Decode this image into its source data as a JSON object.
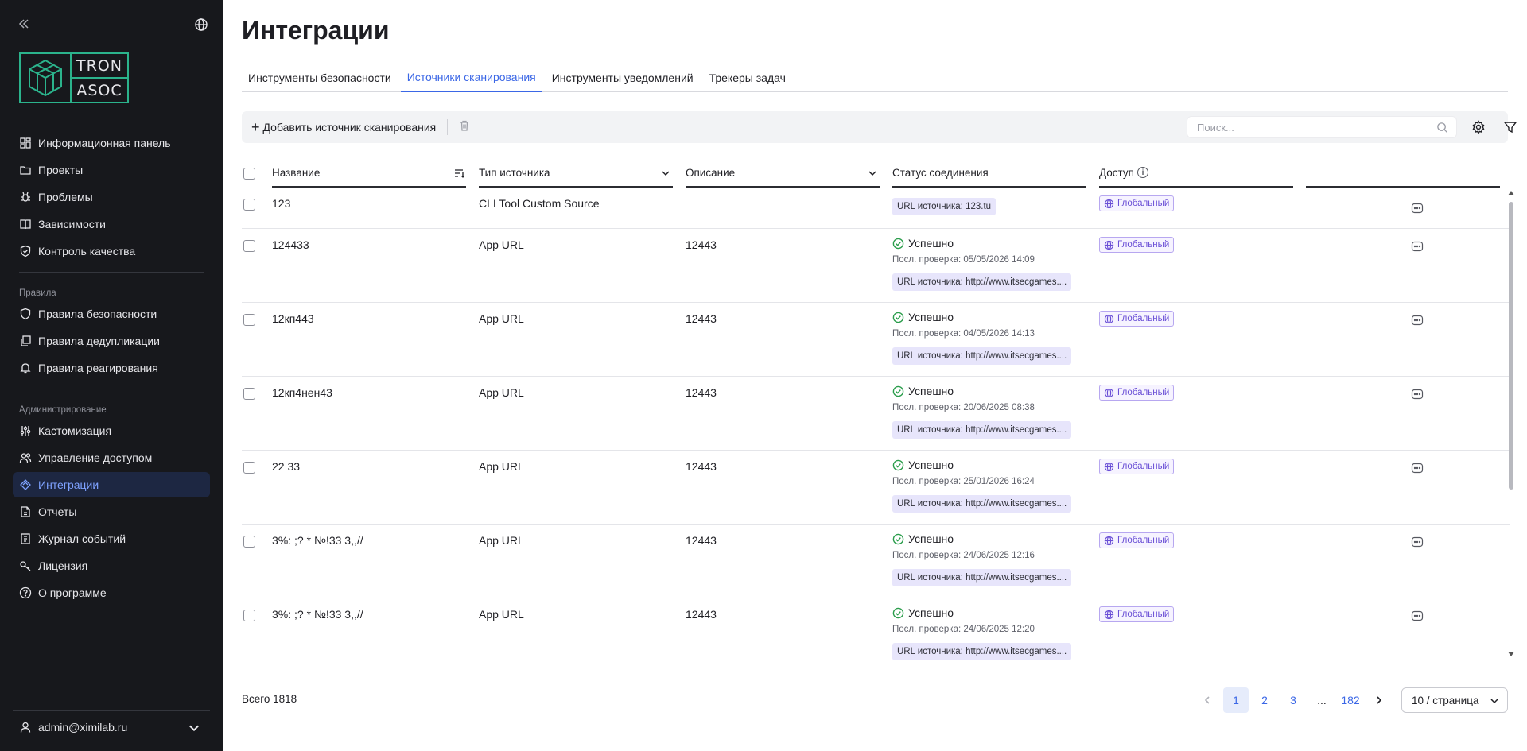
{
  "sidebar": {
    "logo_top": "TRON",
    "logo_bottom": "ASOC",
    "items_main": [
      {
        "label": "Информационная панель",
        "icon": "dashboard-icon"
      },
      {
        "label": "Проекты",
        "icon": "folder-icon"
      },
      {
        "label": "Проблемы",
        "icon": "bug-icon"
      },
      {
        "label": "Зависимости",
        "icon": "book-icon"
      },
      {
        "label": "Контроль качества",
        "icon": "shield-check-icon"
      }
    ],
    "section_rules": "Правила",
    "items_rules": [
      {
        "label": "Правила безопасности",
        "icon": "shield-icon"
      },
      {
        "label": "Правила дедупликации",
        "icon": "copy-icon"
      },
      {
        "label": "Правила реагирования",
        "icon": "bell-icon"
      }
    ],
    "section_admin": "Администрирование",
    "items_admin": [
      {
        "label": "Кастомизация",
        "icon": "sliders-icon"
      },
      {
        "label": "Управление доступом",
        "icon": "users-icon"
      },
      {
        "label": "Интеграции",
        "icon": "integrations-icon",
        "active": true
      },
      {
        "label": "Отчеты",
        "icon": "report-icon"
      },
      {
        "label": "Журнал событий",
        "icon": "journal-icon"
      },
      {
        "label": "Лицензия",
        "icon": "key-icon"
      },
      {
        "label": "О программе",
        "icon": "help-icon"
      }
    ],
    "user": "admin@ximilab.ru"
  },
  "page": {
    "title": "Интеграции",
    "tabs": [
      "Инструменты безопасности",
      "Источники сканирования",
      "Инструменты уведомлений",
      "Трекеры задач"
    ],
    "active_tab": 1
  },
  "toolbar": {
    "add_label": "Добавить источник сканирования",
    "search_placeholder": "Поиск..."
  },
  "table": {
    "headers": {
      "name": "Название",
      "type": "Тип источника",
      "desc": "Описание",
      "status": "Статус соединения",
      "access": "Доступ"
    },
    "rows": [
      {
        "name": "123",
        "type": "CLI Tool Custom Source",
        "desc": "",
        "status": "",
        "last_check": "",
        "url": "URL источника: 123.tu",
        "access": "Глобальный"
      },
      {
        "name": "124433",
        "type": "App URL",
        "desc": "12443",
        "status": "Успешно",
        "last_check": "Посл. проверка: 05/05/2026 14:09",
        "url": "URL источника: http://www.itsecgames....",
        "access": "Глобальный"
      },
      {
        "name": "12кп443",
        "type": "App URL",
        "desc": "12443",
        "status": "Успешно",
        "last_check": "Посл. проверка: 04/05/2026 14:13",
        "url": "URL источника: http://www.itsecgames....",
        "access": "Глобальный"
      },
      {
        "name": "12кп4нен43",
        "type": "App URL",
        "desc": "12443",
        "status": "Успешно",
        "last_check": "Посл. проверка: 20/06/2025 08:38",
        "url": "URL источника: http://www.itsecgames....",
        "access": "Глобальный"
      },
      {
        "name": "22 33",
        "type": "App URL",
        "desc": "12443",
        "status": "Успешно",
        "last_check": "Посл. проверка: 25/01/2026 16:24",
        "url": "URL источника: http://www.itsecgames....",
        "access": "Глобальный"
      },
      {
        "name": "3%: ;? * №!33 3,,//",
        "type": "App URL",
        "desc": "12443",
        "status": "Успешно",
        "last_check": "Посл. проверка: 24/06/2025 12:16",
        "url": "URL источника: http://www.itsecgames....",
        "access": "Глобальный"
      },
      {
        "name": "3%: ;? * №!33 3,,//",
        "type": "App URL",
        "desc": "12443",
        "status": "Успешно",
        "last_check": "Посл. проверка: 24/06/2025 12:20",
        "url": "URL источника: http://www.itsecgames....",
        "access": "Глобальный"
      }
    ]
  },
  "footer": {
    "total": "Всего 1818",
    "pages": [
      "1",
      "2",
      "3",
      "...",
      "182"
    ],
    "current_page": "1",
    "page_size": "10 / страница"
  },
  "colors": {
    "sidebar_bg": "#17181c",
    "accent": "#3b67e6",
    "logo_green": "#2bb38c",
    "success": "#2a9d4b",
    "access_purple": "#6a4fd6",
    "url_badge_bg": "#e7e5fb"
  }
}
